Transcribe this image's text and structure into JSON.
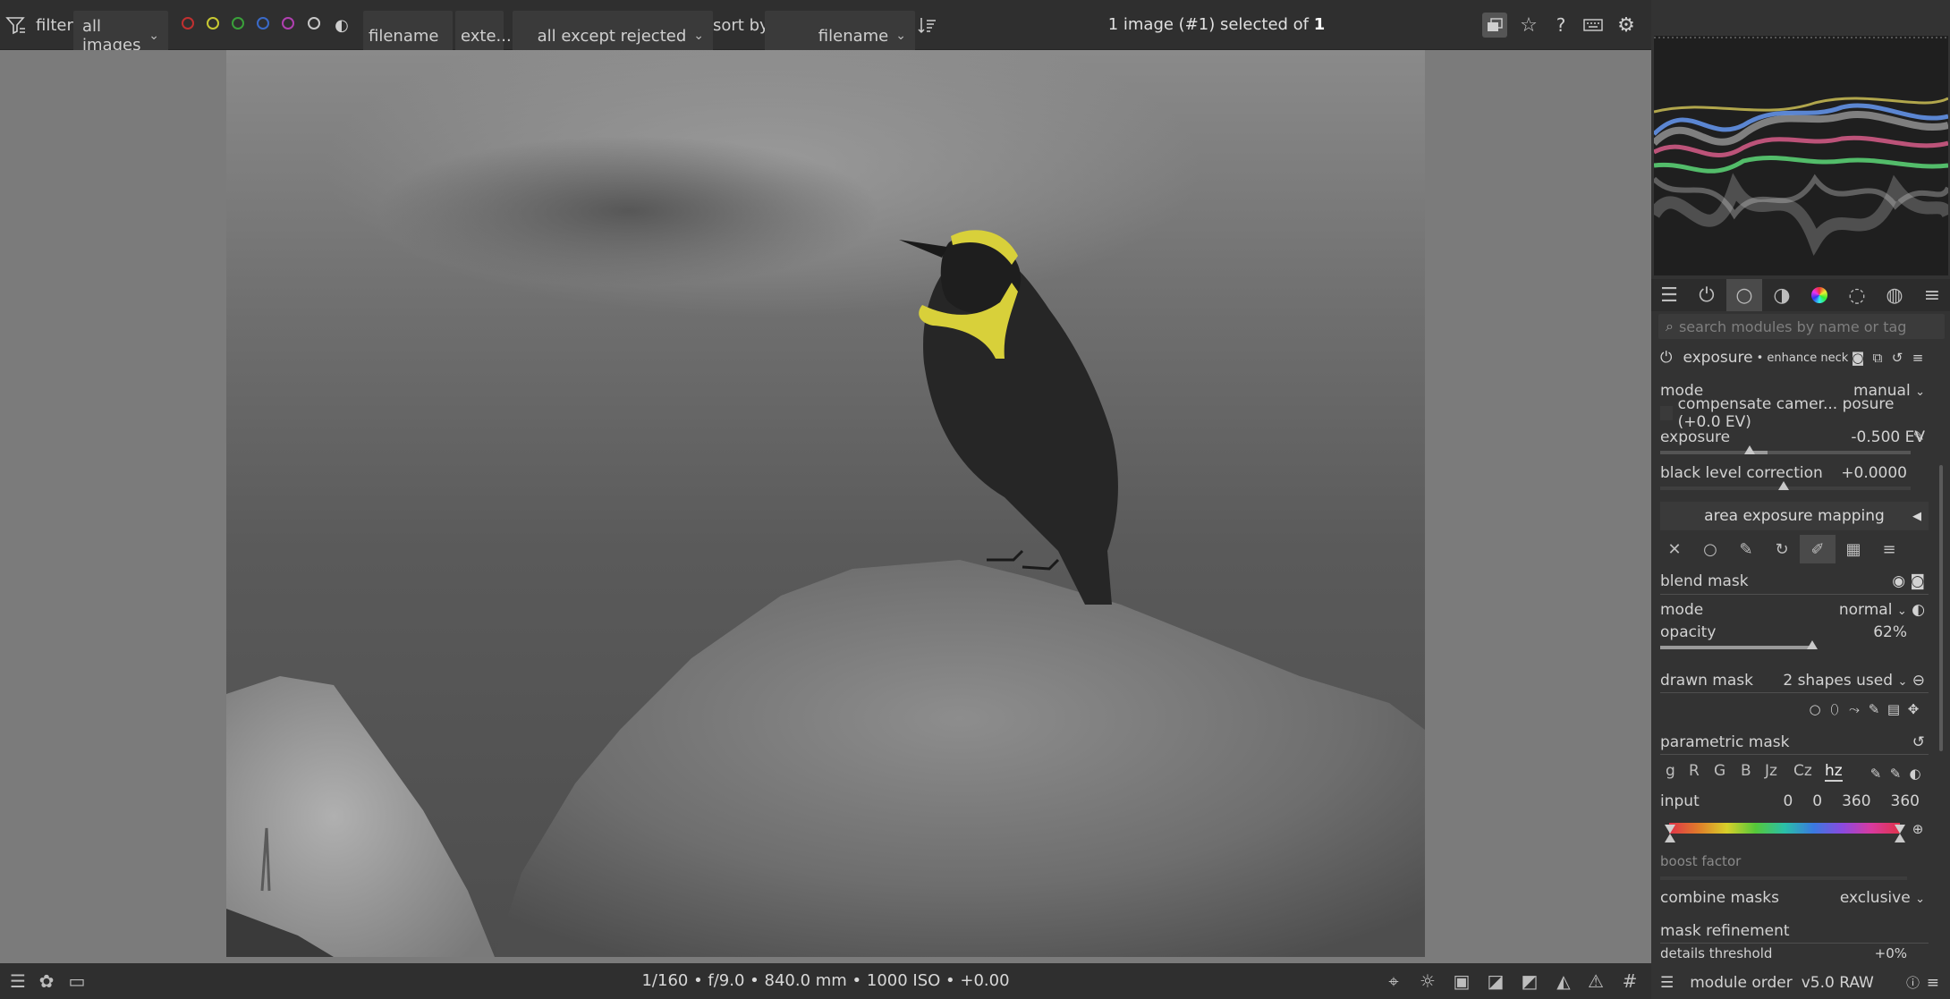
{
  "topbar": {
    "filter_label": "filter",
    "collection_value": "all images",
    "filename_placeholder": "filename",
    "extension_placeholder": "exte...",
    "rating_filter_value": "all except rejected",
    "sort_by_label": "sort by",
    "sort_value": "filename",
    "selection_prefix": "1 image (#1) selected of ",
    "selection_total": "1",
    "color_labels": [
      "#c03030",
      "#c8c832",
      "#3aa03a",
      "#3a6ac8",
      "#b040b0",
      "#c8c8c8"
    ]
  },
  "bottombar": {
    "exif": "1/160 • f/9.0 • 840.0 mm • 1000 ISO • +0.00"
  },
  "module_search": {
    "placeholder": "search modules by name or tag"
  },
  "module": {
    "name": "exposure",
    "instance": "• enhance neck",
    "mode_label": "mode",
    "mode_value": "manual",
    "compensate_label": "compensate camer... posure (+0.0 EV)",
    "exposure_label": "exposure",
    "exposure_value": "-0.500 EV",
    "exposure_level": -0.5,
    "black_level_label": "black level correction",
    "black_level_value": "+0.0000",
    "area_exposure_label": "area exposure mapping"
  },
  "blend": {
    "section_label": "blend mask",
    "mode_label": "mode",
    "mode_value": "normal",
    "opacity_label": "opacity",
    "opacity_value": "62%",
    "opacity_level": 0.62,
    "drawn_mask_label": "drawn mask",
    "drawn_mask_value": "2 shapes used",
    "parametric_label": "parametric mask",
    "channels": [
      "g",
      "R",
      "G",
      "B",
      "Jz",
      "Cz",
      "hz"
    ],
    "active_channel": "hz",
    "input_label": "input",
    "input_values": [
      "0",
      "0",
      "360",
      "360"
    ],
    "boost_label": "boost factor",
    "combine_label": "combine masks",
    "combine_value": "exclusive",
    "refinement_label": "mask refinement",
    "details_label": "details threshold",
    "details_value": "+0%"
  },
  "footer": {
    "module_order_label": "module order",
    "module_order_value": "v5.0 RAW"
  }
}
